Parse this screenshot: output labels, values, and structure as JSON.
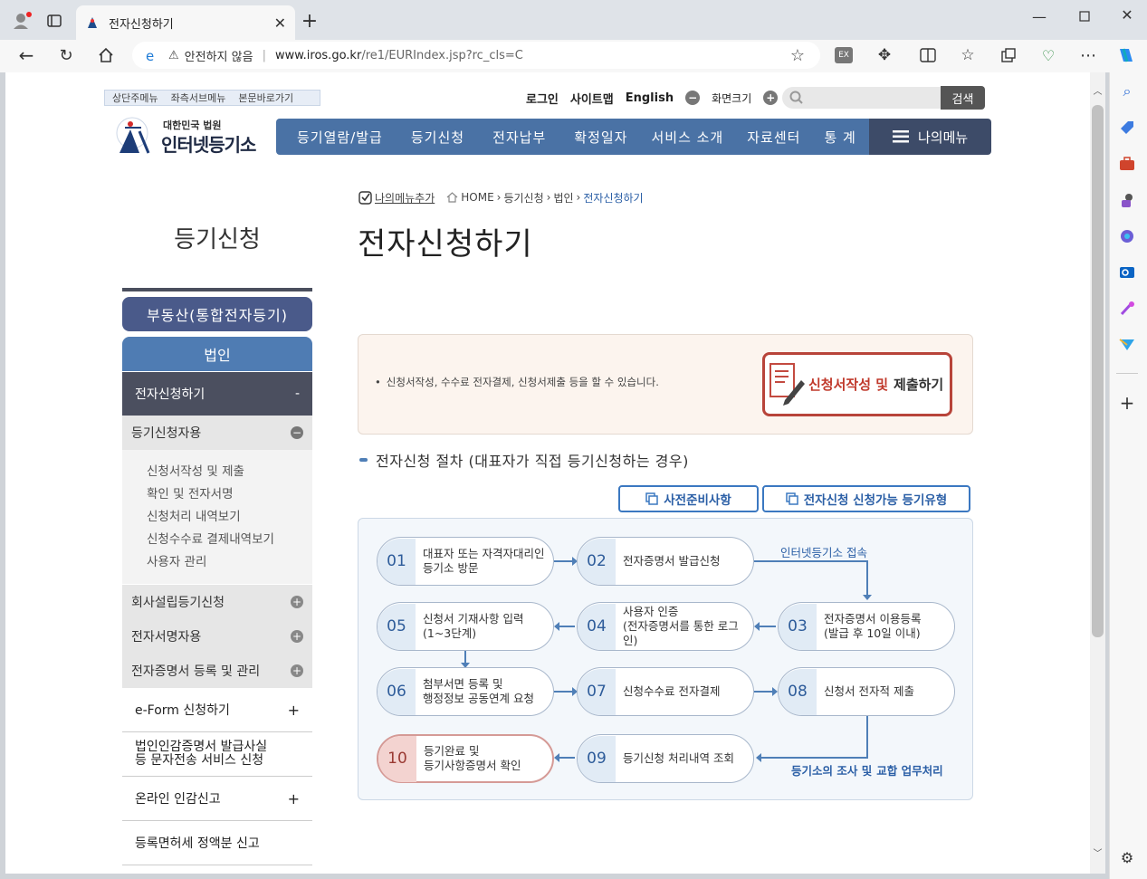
{
  "browser": {
    "tab_title": "전자신청하기",
    "url_warning": "안전하지 않음",
    "url_host": "www.iros.go.kr",
    "url_path": "/re1/EURIndex.jsp?rc_cls=C"
  },
  "header": {
    "skip_links": [
      "상단주메뉴",
      "좌측서브메뉴",
      "본문바로가기"
    ],
    "util": {
      "login": "로그인",
      "sitemap": "사이트맵",
      "english": "English",
      "zoom": "화면크기"
    },
    "search_button": "검색",
    "logo_small": "대한민국 법원",
    "logo_large": "인터넷등기소",
    "gnb": [
      "등기열람/발급",
      "등기신청",
      "전자납부",
      "확정일자",
      "서비스 소개",
      "자료센터",
      "통 계"
    ],
    "my_menu": "나의메뉴"
  },
  "breadcrumb": {
    "my_menu_add": "나의메뉴추가",
    "items": [
      "HOME",
      "등기신청",
      "법인",
      "전자신청하기"
    ]
  },
  "left": {
    "title": "등기신청",
    "btn_realestate": "부동산(통합전자등기)",
    "btn_corp": "법인",
    "active": "전자신청하기",
    "active_sign": "-",
    "group1": "등기신청자용",
    "sub_items": [
      "신청서작성 및 제출",
      "확인 및 전자서명",
      "신청처리 내역보기",
      "신청수수료 결제내역보기",
      "사용자 관리"
    ],
    "groups": [
      "회사설립등기신청",
      "전자서명자용",
      "전자증명서 등록 및 관리"
    ],
    "links": [
      {
        "label": "e-Form 신청하기",
        "sign": "+"
      },
      {
        "label": "법인인감증명서 발급사실\n등 문자전송 서비스 신청",
        "sign": ""
      },
      {
        "label": "온라인 인감신고",
        "sign": "+"
      },
      {
        "label": "등록면허세 정액분 신고",
        "sign": ""
      }
    ]
  },
  "main": {
    "title": "전자신청하기",
    "info_text": "신청서작성, 수수료 전자결제, 신청서제출 등을 할 수 있습니다.",
    "submit_btn_red": "신청서작성 및",
    "submit_btn_dark": "제출하기",
    "section_title": "전자신청 절차 (대표자가 직접 등기신청하는 경우)",
    "btn_prep": "사전준비사항",
    "btn_types": "전자신청 신청가능 등기유형",
    "label_access": "인터넷등기소 접속",
    "label_review_blue": "등기소의 조사 및",
    "label_review_dark": "교합 업무처리",
    "steps": [
      {
        "num": "01",
        "text": "대표자 또는 자격자대리인\n등기소 방문"
      },
      {
        "num": "02",
        "text": "전자증명서 발급신청"
      },
      {
        "num": "03",
        "text": "전자증명서 이용등록\n(발급 후 10일 이내)"
      },
      {
        "num": "04",
        "text": "사용자 인증\n(전자증명서를 통한 로그인)"
      },
      {
        "num": "05",
        "text": "신청서 기재사항 입력\n(1~3단계)"
      },
      {
        "num": "06",
        "text": "첨부서면 등록 및\n행정정보 공동연계 요청"
      },
      {
        "num": "07",
        "text": "신청수수료 전자결제"
      },
      {
        "num": "08",
        "text": "신청서 전자적 제출"
      },
      {
        "num": "09",
        "text": "등기신청 처리내역 조회"
      },
      {
        "num": "10",
        "text": "등기완료 및\n등기사항증명서 확인"
      }
    ]
  }
}
